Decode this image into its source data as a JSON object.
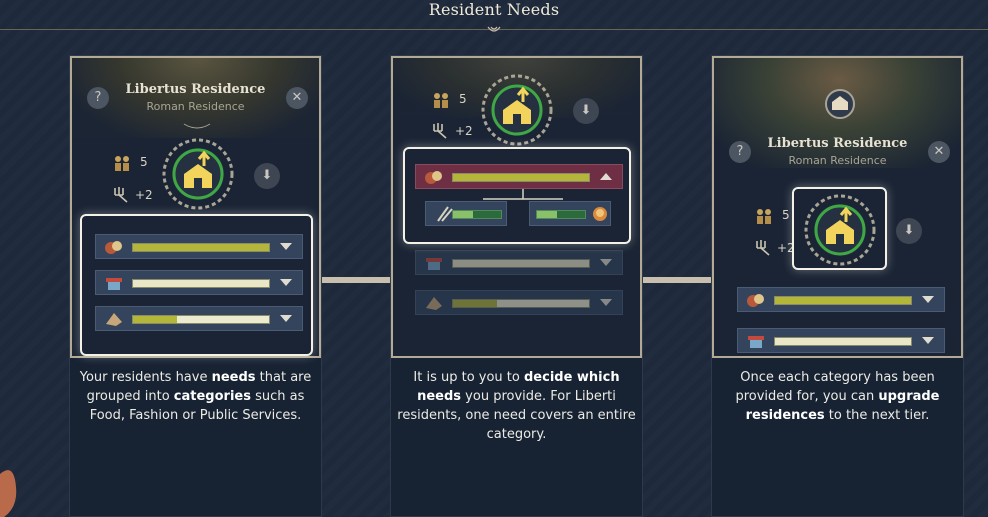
{
  "header": {
    "title": "Resident Needs"
  },
  "residence": {
    "name": "Libertus Residence",
    "subtitle": "Roman Residence",
    "population": "5",
    "bonus": "+2"
  },
  "captions": [
    {
      "parts": [
        {
          "t": "Your residents have ",
          "b": false
        },
        {
          "t": "needs",
          "b": true
        },
        {
          "t": " that are grouped into ",
          "b": false
        },
        {
          "t": "categories",
          "b": true
        },
        {
          "t": " such as Food, Fashion or Public Services.",
          "b": false
        }
      ]
    },
    {
      "parts": [
        {
          "t": "It is up to you to ",
          "b": false
        },
        {
          "t": "decide which needs",
          "b": true
        },
        {
          "t": " you provide. For Liberti residents, one need covers an entire category.",
          "b": false
        }
      ]
    },
    {
      "parts": [
        {
          "t": "Once each category has been provided for, you can ",
          "b": false
        },
        {
          "t": "upgrade residences",
          "b": true
        },
        {
          "t": " to the next tier.",
          "b": false
        }
      ]
    }
  ],
  "needs_panel1": [
    {
      "category": "food-icon",
      "fill": 1.0
    },
    {
      "category": "fashion-market-icon",
      "fill": 1.0
    },
    {
      "category": "public-services-icon",
      "fill": 0.32
    }
  ],
  "needs_panel2": {
    "expanded": {
      "category": "food-icon",
      "fill": 1.0
    },
    "subneeds": [
      {
        "need": "wheat-icon",
        "fill": 0.42
      },
      {
        "need": "bowl-icon",
        "fill": 0.42
      }
    ],
    "collapsed": [
      {
        "category": "fashion-market-icon",
        "fill": 1.0
      },
      {
        "category": "public-services-icon",
        "fill": 0.32
      }
    ]
  },
  "needs_panel3": [
    {
      "category": "food-icon",
      "fill": 1.0
    },
    {
      "category": "fashion-market-icon",
      "fill": 1.0
    }
  ],
  "colors": {
    "need_fill": "#b4b63a",
    "tier_ring": "#3fa844",
    "house": "#f2d45c"
  }
}
